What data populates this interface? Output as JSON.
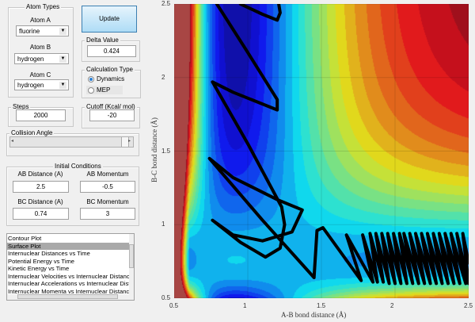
{
  "atom_types": {
    "title": "Atom Types",
    "atom_a_label": "Atom A",
    "atom_a": "fluorine",
    "atom_b_label": "Atom B",
    "atom_b": "hydrogen",
    "atom_c_label": "Atom C",
    "atom_c": "hydrogen"
  },
  "update_label": "Update",
  "delta": {
    "title": "Delta Value",
    "value": "0.424"
  },
  "calc_type": {
    "title": "Calculation Type",
    "options": [
      "Dynamics",
      "MEP"
    ],
    "selected": "Dynamics"
  },
  "steps": {
    "title": "Steps",
    "value": "2000"
  },
  "cutoff": {
    "title": "Cutoff (Kcal/ mol)",
    "value": "-20"
  },
  "collision": {
    "title": "Collision Angle",
    "slider_fraction": 1.0
  },
  "initial": {
    "title": "Initial Conditions",
    "ab_dist_label": "AB Distance (A)",
    "ab_dist": "2.5",
    "ab_mom_label": "AB Momentum",
    "ab_mom": "-0.5",
    "bc_dist_label": "BC Distance (A)",
    "bc_dist": "0.74",
    "bc_mom_label": "BC Momentum",
    "bc_mom": "3"
  },
  "plot_list": {
    "items": [
      "Contour Plot",
      "Surface Plot",
      "Internuclear Distances vs Time",
      "Potential Energy vs Time",
      "Kinetic Energy vs Time",
      "Internuclear Velocities vs Internuclear Distance",
      "Internuclear Accelerations vs Internuclear Dista",
      "Internuclear Momenta vs Internuclear Distance"
    ],
    "selected": "Surface Plot"
  },
  "chart_data": {
    "type": "contour",
    "xlabel": "A-B bond distance (Å)",
    "ylabel": "B-C bond distance (Å)",
    "xlim": [
      0.5,
      2.5
    ],
    "ylim": [
      0.5,
      2.5
    ],
    "xticks": [
      "0.5",
      "1",
      "1.5",
      "2",
      "2.5"
    ],
    "yticks": [
      "0.5",
      "1",
      "1.5",
      "2",
      "2.5"
    ],
    "colormap": "jet",
    "grid": true,
    "trajectory": [
      [
        [
          2.5,
          0.74
        ],
        [
          2.46,
          0.94
        ],
        [
          2.5,
          0.6
        ],
        [
          2.42,
          0.94
        ],
        [
          2.48,
          0.6
        ],
        [
          2.38,
          0.94
        ],
        [
          2.44,
          0.6
        ],
        [
          2.34,
          0.94
        ],
        [
          2.4,
          0.6
        ],
        [
          2.3,
          0.94
        ],
        [
          2.36,
          0.6
        ],
        [
          2.26,
          0.94
        ],
        [
          2.32,
          0.6
        ],
        [
          2.22,
          0.94
        ],
        [
          2.28,
          0.6
        ],
        [
          2.18,
          0.94
        ],
        [
          2.24,
          0.6
        ],
        [
          2.14,
          0.94
        ],
        [
          2.2,
          0.6
        ],
        [
          2.1,
          0.94
        ],
        [
          2.16,
          0.6
        ],
        [
          2.06,
          0.94
        ],
        [
          2.12,
          0.6
        ],
        [
          2.03,
          0.94
        ],
        [
          2.08,
          0.6
        ],
        [
          1.99,
          0.94
        ],
        [
          2.04,
          0.6
        ],
        [
          1.95,
          0.94
        ],
        [
          2.0,
          0.6
        ],
        [
          1.91,
          0.94
        ],
        [
          1.96,
          0.6
        ],
        [
          1.87,
          0.94
        ],
        [
          1.92,
          0.61
        ],
        [
          1.83,
          0.94
        ],
        [
          1.88,
          0.61
        ],
        [
          1.78,
          0.93
        ],
        [
          1.85,
          0.61
        ],
        [
          1.67,
          0.93
        ],
        [
          1.77,
          0.62
        ],
        [
          1.51,
          0.98
        ],
        [
          1.47,
          0.96
        ],
        [
          1.45,
          0.64
        ],
        [
          1.1,
          1.03
        ],
        [
          0.74,
          1.45
        ],
        [
          0.9,
          1.32
        ],
        [
          1.2,
          1.17
        ],
        [
          1.37,
          1.1
        ],
        [
          1.3,
          0.95
        ],
        [
          1.1,
          0.89
        ],
        [
          0.9,
          0.93
        ],
        [
          0.76,
          1.03
        ],
        [
          0.95,
          0.88
        ],
        [
          1.12,
          0.78
        ],
        [
          1.22,
          0.84
        ],
        [
          1.25,
          1.0
        ],
        [
          1.23,
          1.12
        ],
        [
          1.0,
          1.55
        ],
        [
          0.76,
          1.97
        ],
        [
          0.9,
          1.9
        ],
        [
          1.2,
          1.78
        ],
        [
          1.2,
          1.85
        ],
        [
          1.0,
          2.17
        ],
        [
          0.79,
          2.5
        ]
      ],
      [
        [
          0.95,
          2.5
        ],
        [
          1.1,
          2.43
        ],
        [
          1.2,
          2.39
        ],
        [
          1.22,
          2.44
        ],
        [
          1.21,
          2.5
        ]
      ]
    ],
    "trajectory_color": "#000000"
  }
}
